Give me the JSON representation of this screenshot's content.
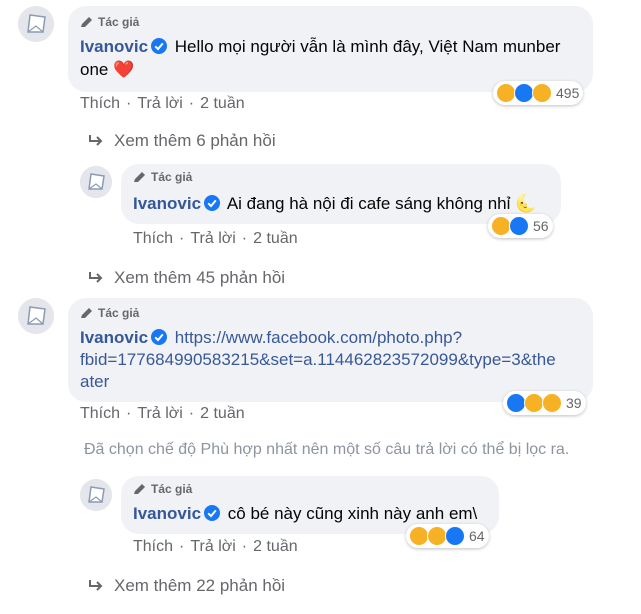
{
  "common": {
    "author_tag": "Tác giả",
    "like": "Thích",
    "reply": "Trả lời",
    "time": "2 tuần",
    "name": "Ivanovic"
  },
  "comments": [
    {
      "text1": "Hello mọi người vẫn là mình đây, Việt Nam munber",
      "text2": "one ❤️",
      "reaction_count": "495",
      "reaction_icons": [
        "haha-icon",
        "like-icon",
        "sad-icon"
      ]
    },
    {
      "text1": "Ai đang hà nội đi cafe sáng không nhỉ 🌜",
      "reaction_count": "56",
      "reaction_icons": [
        "haha-icon",
        "like-icon"
      ]
    },
    {
      "text1": "https://www.facebook.com/photo.php?",
      "text2": "fbid=177684990583215&set=a.114462823572099&type=3&the",
      "text3": "ater",
      "reaction_count": "39",
      "reaction_icons": [
        "like-icon",
        "haha-icon",
        "sad-icon"
      ]
    },
    {
      "text1": "cô bé này cũng xinh này anh em\\",
      "reaction_count": "64",
      "reaction_icons": [
        "haha-icon",
        "sad-icon",
        "like-icon"
      ]
    }
  ],
  "more_replies": [
    "Xem thêm 6 phản hồi",
    "Xem thêm 45 phản hồi",
    "Xem thêm 22 phản hồi"
  ],
  "filter_notice": "Đã chọn chế độ Phù hợp nhất nên một số câu trả lời có thể bị lọc ra.",
  "colors": {
    "bubble": "#f0f2f5",
    "name": "#365899",
    "link": "#385898",
    "muted": "#65676b",
    "verified": "#1877f2"
  }
}
